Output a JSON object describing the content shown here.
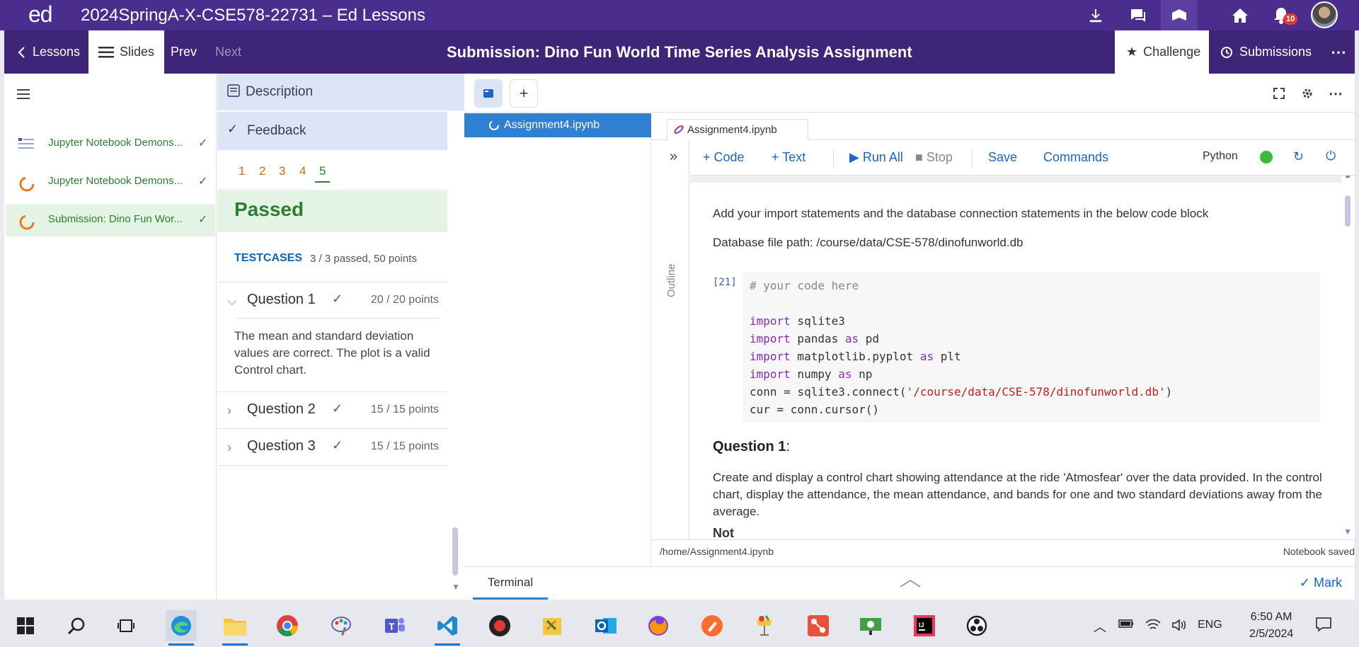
{
  "titlebar": {
    "logo": "ed",
    "course": "2024SpringA-X-CSE578-22731 – Ed Lessons",
    "notification_count": "10"
  },
  "nav": {
    "lessons_label": "Lessons",
    "slides_label": "Slides",
    "prev_label": "Prev",
    "next_label": "Next",
    "page_title": "Submission: Dino Fun World Time Series Analysis Assignment",
    "challenge_label": "Challenge",
    "submissions_label": "Submissions"
  },
  "lessons": [
    {
      "label": "Jupyter Notebook Demons...",
      "icon": "slide-list-icon"
    },
    {
      "label": "Jupyter Notebook Demons...",
      "icon": "progress-ring-icon"
    },
    {
      "label": "Submission: Dino Fun Wor...",
      "icon": "progress-ring-icon"
    }
  ],
  "feedback": {
    "description_label": "Description",
    "feedback_label": "Feedback",
    "attempts": [
      "1",
      "2",
      "3",
      "4",
      "5"
    ],
    "status": "Passed",
    "testcases_label": "TESTCASES",
    "testcases_summary": "3 / 3 passed, 50 points",
    "questions": [
      {
        "label": "Question 1",
        "points": "20 / 20 points"
      },
      {
        "label": "Question 2",
        "points": "15 / 15 points"
      },
      {
        "label": "Question 3",
        "points": "15 / 15 points"
      }
    ],
    "q1_feedback": "The mean and standard deviation values are correct. The plot is a valid Control chart."
  },
  "notebook": {
    "file_name": "Assignment4.ipynb",
    "tab_name": "Assignment4.ipynb",
    "outline_label": "Outline",
    "toolbar": {
      "code": "Code",
      "text": "Text",
      "run_all": "Run All",
      "stop": "Stop",
      "save": "Save",
      "commands": "Commands",
      "kernel": "Python"
    },
    "md1": "Add your import statements and the database connection statements in the below code block",
    "md2": "Database file path: /course/data/CSE-578/dinofunworld.db",
    "exec_count": "[21]",
    "code": {
      "comment": "# your code here",
      "l1_kw": "import",
      "l1_rest": " sqlite3",
      "l2_kw": "import",
      "l2_mid": " pandas ",
      "l2_as": "as",
      "l2_rest": " pd",
      "l3_kw": "import",
      "l3_mid": " matplotlib.pyplot ",
      "l3_as": "as",
      "l3_rest": " plt",
      "l4_kw": "import",
      "l4_mid": " numpy ",
      "l4_as": "as",
      "l4_rest": " np",
      "l5_pre": "conn = sqlite3.connect(",
      "l5_str": "'/course/data/CSE-578/dinofunworld.db'",
      "l5_post": ")",
      "l6": "cur = conn.cursor()"
    },
    "q1_title": "Question 1",
    "q1_colon": ":",
    "q1_desc": "Create and display a control chart showing attendance at the ride 'Atmosfear' over the data provided. In the control chart, display the attendance, the mean attendance, and bands for one and two standard deviations away from the average.",
    "q1_next": "Not",
    "status_path": "/home/Assignment4.ipynb",
    "status_saved": "Notebook saved"
  },
  "bottom": {
    "terminal_label": "Terminal",
    "mark_label": "Mark"
  },
  "taskbar": {
    "language": "ENG",
    "time": "6:50 AM",
    "date": "2/5/2024"
  }
}
